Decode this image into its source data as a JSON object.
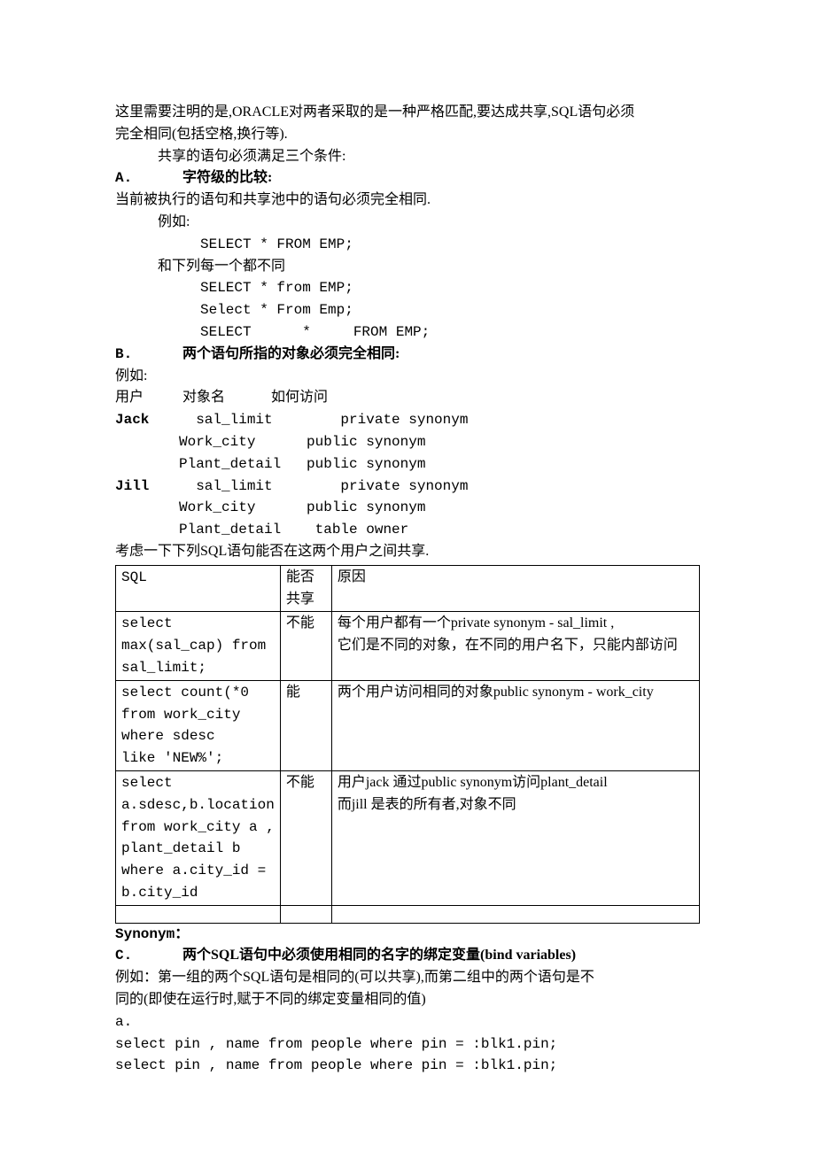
{
  "para1": "这里需要注明的是,ORACLE对两者采取的是一种严格匹配,要达成共享,SQL语句必须",
  "para2": "完全相同(包括空格,换行等).",
  "para3": "共享的语句必须满足三个条件:",
  "secA": {
    "label": "A.",
    "title": "字符级的比较:"
  },
  "secA_line1": "当前被执行的语句和共享池中的语句必须完全相同.",
  "secA_ex": "例如:",
  "secA_sql1": "SELECT * FROM EMP;",
  "secA_diff": "和下列每一个都不同",
  "secA_sql2": "SELECT * from EMP;",
  "secA_sql3": "Select * From Emp;",
  "secA_sql4": "SELECT      *     FROM EMP;",
  "secB": {
    "label": "B.",
    "title": "两个语句所指的对象必须完全相同:"
  },
  "secB_ex": "例如:",
  "secB_header": {
    "user": "用户",
    "obj": "对象名",
    "how": "如何访问"
  },
  "secB_rows": {
    "jack": "Jack",
    "jack1": "  sal_limit        private synonym",
    "jack2": "Work_city      public synonym",
    "jack3": "Plant_detail   public synonym",
    "jill": "Jill",
    "jill1": "  sal_limit        private synonym",
    "jill2": "Work_city      public synonym",
    "jill3": "Plant_detail    table owner"
  },
  "secB_consider": "考虑一下下列SQL语句能否在这两个用户之间共享.",
  "table": {
    "headers": {
      "sql": "SQL",
      "share": "能否共享",
      "reason": "原因"
    },
    "rows": [
      {
        "sql": [
          "select",
          "max(sal_cap) from",
          "sal_limit;"
        ],
        "share": "不能",
        "reason": [
          "每个用户都有一个private synonym - sal_limit ,",
          "它们是不同的对象，在不同的用户名下，只能内部访问"
        ]
      },
      {
        "sql": [
          "select count(*0",
          "from work_city",
          "where sdesc",
          "like 'NEW%';"
        ],
        "share": "能",
        "reason": [
          "两个用户访问相同的对象public synonym - work_city"
        ]
      },
      {
        "sql": [
          "select",
          "a.sdesc,b.location",
          "from work_city a ,",
          "plant_detail b",
          "where a.city_id =",
          "b.city_id"
        ],
        "share": "不能",
        "reason": [
          "用户jack 通过public synonym访问plant_detail",
          "而jill 是表的所有者,对象不同"
        ]
      }
    ]
  },
  "synonym": "Synonym：",
  "secC": {
    "label": "C.",
    "title": "两个SQL语句中必须使用相同的名字的绑定变量(bind variables)"
  },
  "secC_l1": "例如：第一组的两个SQL语句是相同的(可以共享),而第二组中的两个语句是不",
  "secC_l2": "同的(即使在运行时,赋于不同的绑定变量相同的值)",
  "secC_a": "a.",
  "secC_sql1": "select pin , name from people where pin = :blk1.pin;",
  "secC_sql2": "select pin , name from people where pin = :blk1.pin;"
}
